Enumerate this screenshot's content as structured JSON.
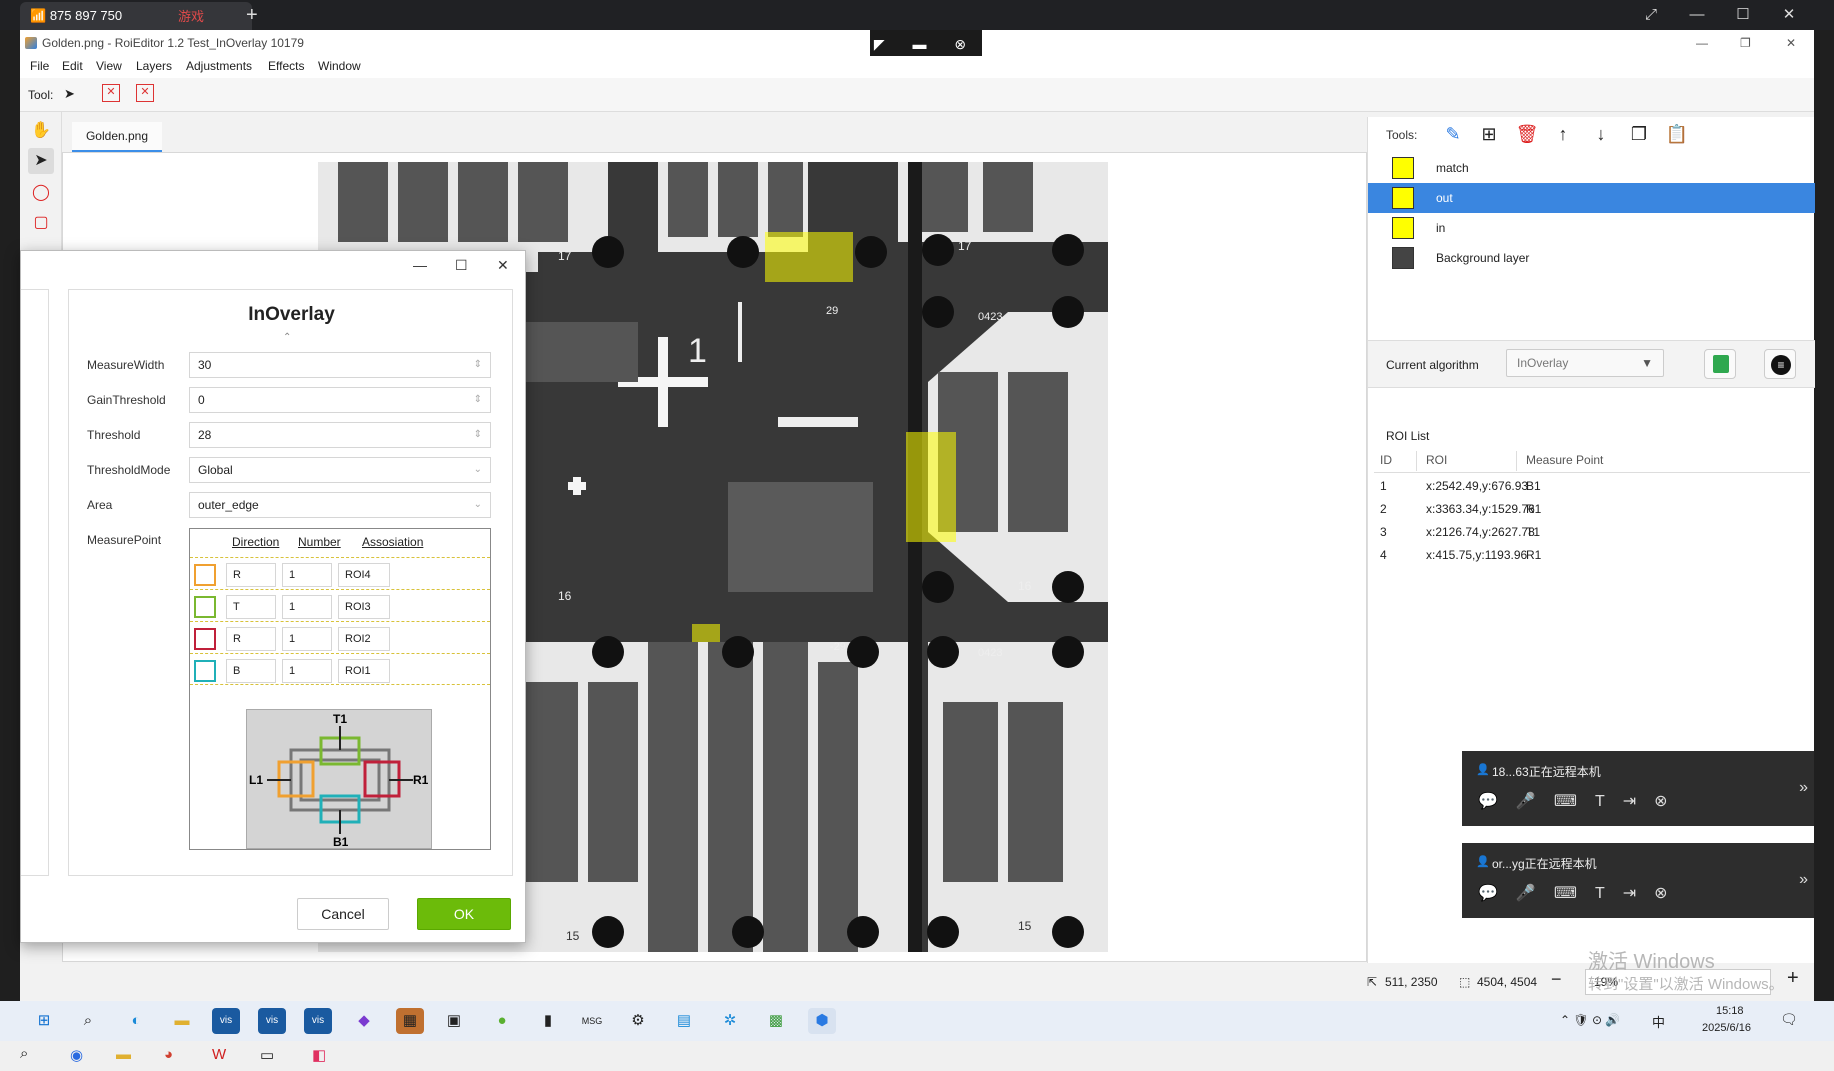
{
  "remote": {
    "tab_title": "875 897 750",
    "tab2_title": "游戏",
    "new_tab": "+",
    "ctrl_icons": "◤ ▬ ⊗"
  },
  "app": {
    "title": "Golden.png - RoiEditor 1.2 Test_InOverlay 10179",
    "menus": [
      "File",
      "Edit",
      "View",
      "Layers",
      "Adjustments",
      "Effects",
      "Window"
    ],
    "tool_label": "Tool:",
    "doc_tab": "Golden.png"
  },
  "right_panel": {
    "tools_label": "Tools:",
    "layers": [
      {
        "name": "match"
      },
      {
        "name": "out"
      },
      {
        "name": "in"
      },
      {
        "name": "Background layer"
      }
    ],
    "current_algorithm_label": "Current algorithm",
    "current_algorithm_value": "InOverlay",
    "roi_list_title": "ROI List",
    "roi_headers": [
      "ID",
      "ROI",
      "Measure Point"
    ],
    "roi_rows": [
      {
        "id": "1",
        "roi": "x:2542.49,y:676.93",
        "mp": "B1"
      },
      {
        "id": "2",
        "roi": "x:3363.34,y:1529.76",
        "mp": "R1"
      },
      {
        "id": "3",
        "roi": "x:2126.74,y:2627.78",
        "mp": "T1"
      },
      {
        "id": "4",
        "roi": "x:415.75,y:1193.96",
        "mp": "R1"
      }
    ]
  },
  "status": {
    "cursor": "511, 2350",
    "size": "4504, 4504",
    "zoom": "19%"
  },
  "dialog": {
    "title": "InOverlay",
    "fields": [
      {
        "label": "MeasureWidth",
        "value": "30"
      },
      {
        "label": "GainThreshold",
        "value": "0"
      },
      {
        "label": "Threshold",
        "value": "28"
      },
      {
        "label": "ThresholdMode",
        "value": "Global"
      },
      {
        "label": "Area",
        "value": "outer_edge"
      }
    ],
    "measure_point_label": "MeasurePoint",
    "mp_headers": [
      "Direction",
      "Number",
      "Assosiation"
    ],
    "mp_rows": [
      {
        "color": "#f0a030",
        "direction": "R",
        "number": "1",
        "assoc": "ROI4"
      },
      {
        "color": "#7ab830",
        "direction": "T",
        "number": "1",
        "assoc": "ROI3"
      },
      {
        "color": "#c0203a",
        "direction": "R",
        "number": "1",
        "assoc": "ROI2"
      },
      {
        "color": "#20b0b8",
        "direction": "B",
        "number": "1",
        "assoc": "ROI1"
      }
    ],
    "diagram_labels": {
      "t": "T1",
      "b": "B1",
      "l": "L1",
      "r": "R1"
    },
    "cancel": "Cancel",
    "ok": "OK"
  },
  "notifications": [
    {
      "text": "18...63正在远程本机"
    },
    {
      "text": "or...yg正在远程本机"
    }
  ],
  "watermark": {
    "line1": "激活 Windows",
    "line2": "转到\"设置\"以激活 Windows。"
  },
  "taskbar": {
    "time": "15:18",
    "date": "2025/6/16",
    "ime": "中"
  },
  "image_labels": {
    "l1": "17",
    "l2": "17",
    "l3": "0423",
    "l4": "16",
    "l5": "16",
    "l6": "-29",
    "l7": "0423",
    "l8": "15",
    "l9": "15",
    "l10": "1",
    "l11": "29"
  }
}
